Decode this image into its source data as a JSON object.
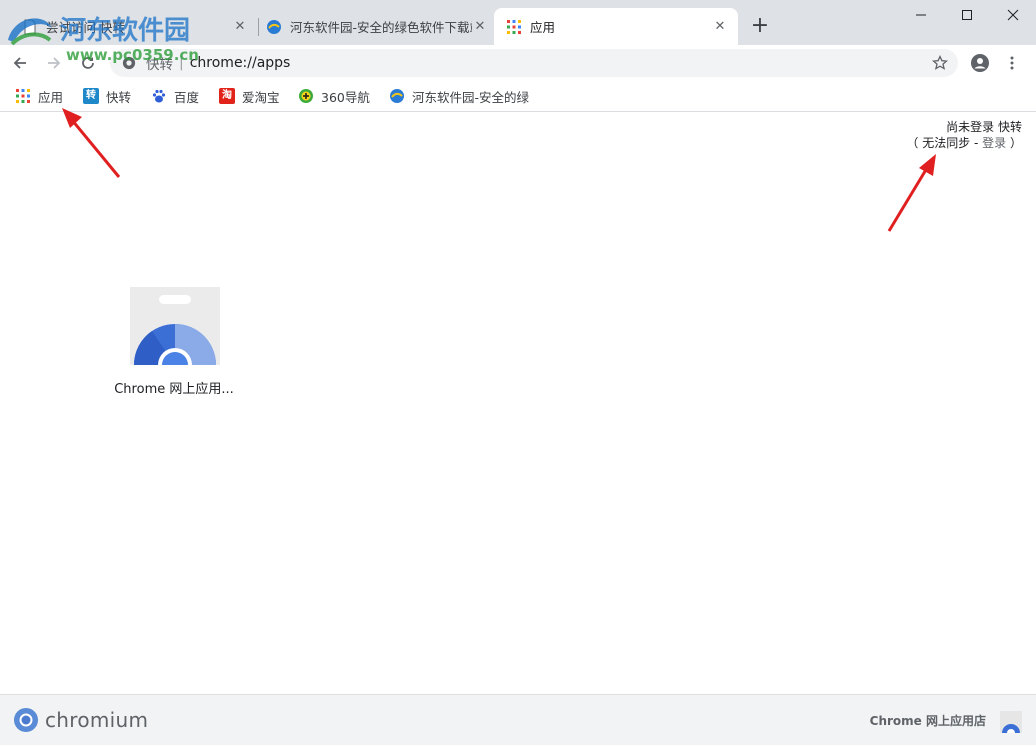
{
  "tabs": [
    {
      "title": "尝试访问 快转",
      "active": false
    },
    {
      "title": "河东软件园-安全的绿色软件下载站",
      "active": false
    },
    {
      "title": "应用",
      "active": true
    }
  ],
  "omnibox": {
    "chip": "快转",
    "url": "chrome://apps"
  },
  "bookmarks": [
    {
      "label": "应用",
      "icon": "apps-grid-icon"
    },
    {
      "label": "快转",
      "icon": "kuaizhuan-icon"
    },
    {
      "label": "百度",
      "icon": "baidu-paw-icon"
    },
    {
      "label": "爱淘宝",
      "icon": "taobao-icon"
    },
    {
      "label": "360导航",
      "icon": "360-icon"
    },
    {
      "label": "河东软件园-安全的绿",
      "icon": "hedong-icon"
    }
  ],
  "signin": {
    "line1": "尚未登录 快转",
    "line2_prefix": "（ 无法同步 - ",
    "link": "登录",
    "line2_suffix": " ）"
  },
  "apps": [
    {
      "label": "Chrome 网上应用..."
    }
  ],
  "footer": {
    "brand": "chromium",
    "store_link": "Chrome 网上应用店"
  },
  "watermark": {
    "main": "河东软件园",
    "sub": "www.pc0359.cn"
  },
  "colors": {
    "accent": "#1a73e8",
    "titlebar": "#dee1e6",
    "arrow": "#e02020"
  }
}
